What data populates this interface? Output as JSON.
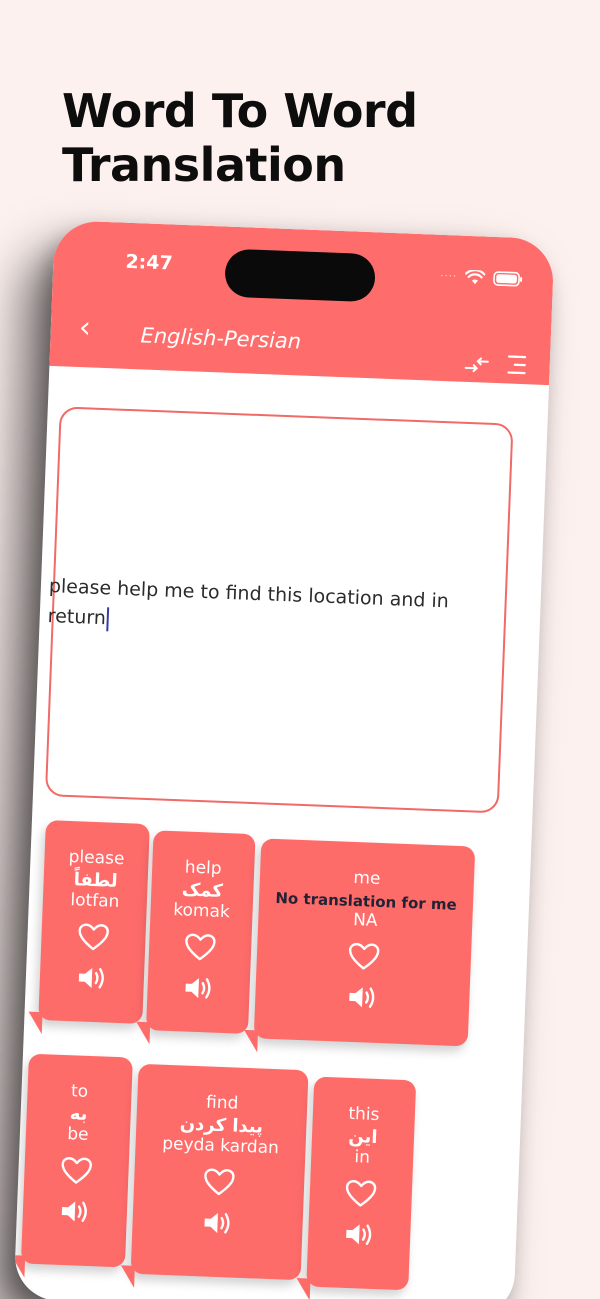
{
  "headline": {
    "line1": "Word To Word",
    "line2": "Translation"
  },
  "status": {
    "time": "2:47",
    "dots": "····"
  },
  "appbar": {
    "back": "‹",
    "title": "English-Persian"
  },
  "input": {
    "text": "please help me to find this location and in return"
  },
  "cards": [
    {
      "word": "please",
      "persian": "لطفاً",
      "translit": "lotfan"
    },
    {
      "word": "help",
      "persian": "کمک",
      "translit": "komak"
    },
    {
      "word": "me",
      "note": "No translation for me",
      "translit": "NA"
    },
    {
      "word": "to",
      "persian": "به",
      "translit": "be"
    },
    {
      "word": "find",
      "persian": "پیدا کردن",
      "translit": "peyda kardan"
    },
    {
      "word": "this",
      "persian": "این",
      "translit": "in"
    }
  ],
  "colors": {
    "accent": "#fe6d6b",
    "background": "#fdf1ef",
    "text": "#0d0d0d"
  }
}
